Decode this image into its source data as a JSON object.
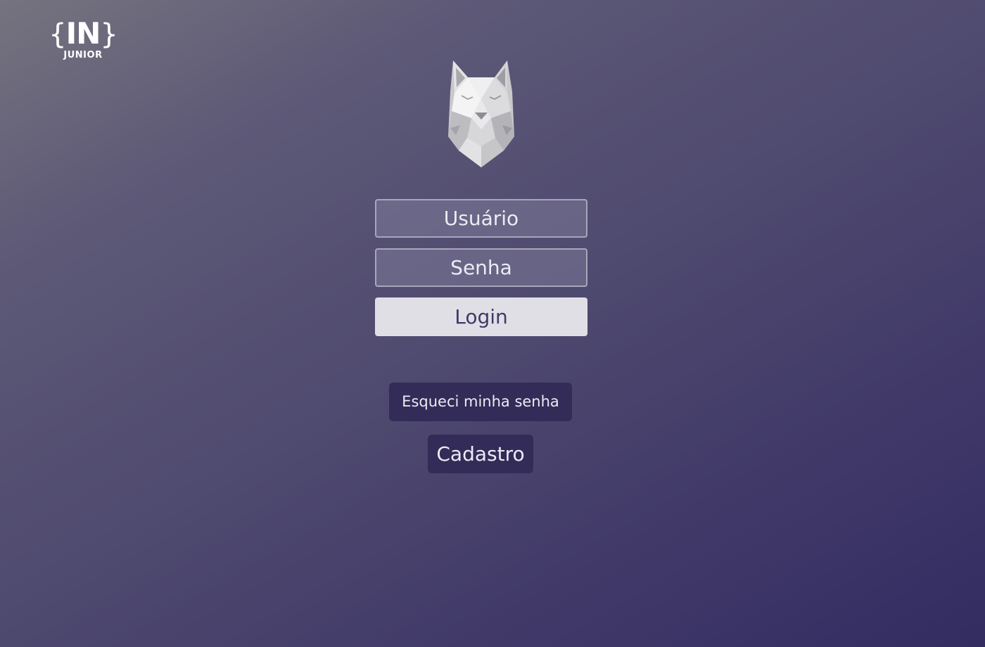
{
  "brand": {
    "logo_main": "IN",
    "logo_brace_open": "{",
    "logo_brace_close": "}",
    "logo_sub": "JUNIOR"
  },
  "mascot": {
    "icon": "wolf-icon"
  },
  "login_form": {
    "username_placeholder": "Usuário",
    "password_placeholder": "Senha",
    "login_label": "Login"
  },
  "links": {
    "forgot_password_label": "Esqueci minha senha",
    "signup_label": "Cadastro"
  },
  "colors": {
    "background_top": "#76737f",
    "background_bottom": "#332c61",
    "login_button_bg": "#e1dfe6",
    "login_button_text": "#3f3a66",
    "secondary_button_bg": "#332c58"
  }
}
